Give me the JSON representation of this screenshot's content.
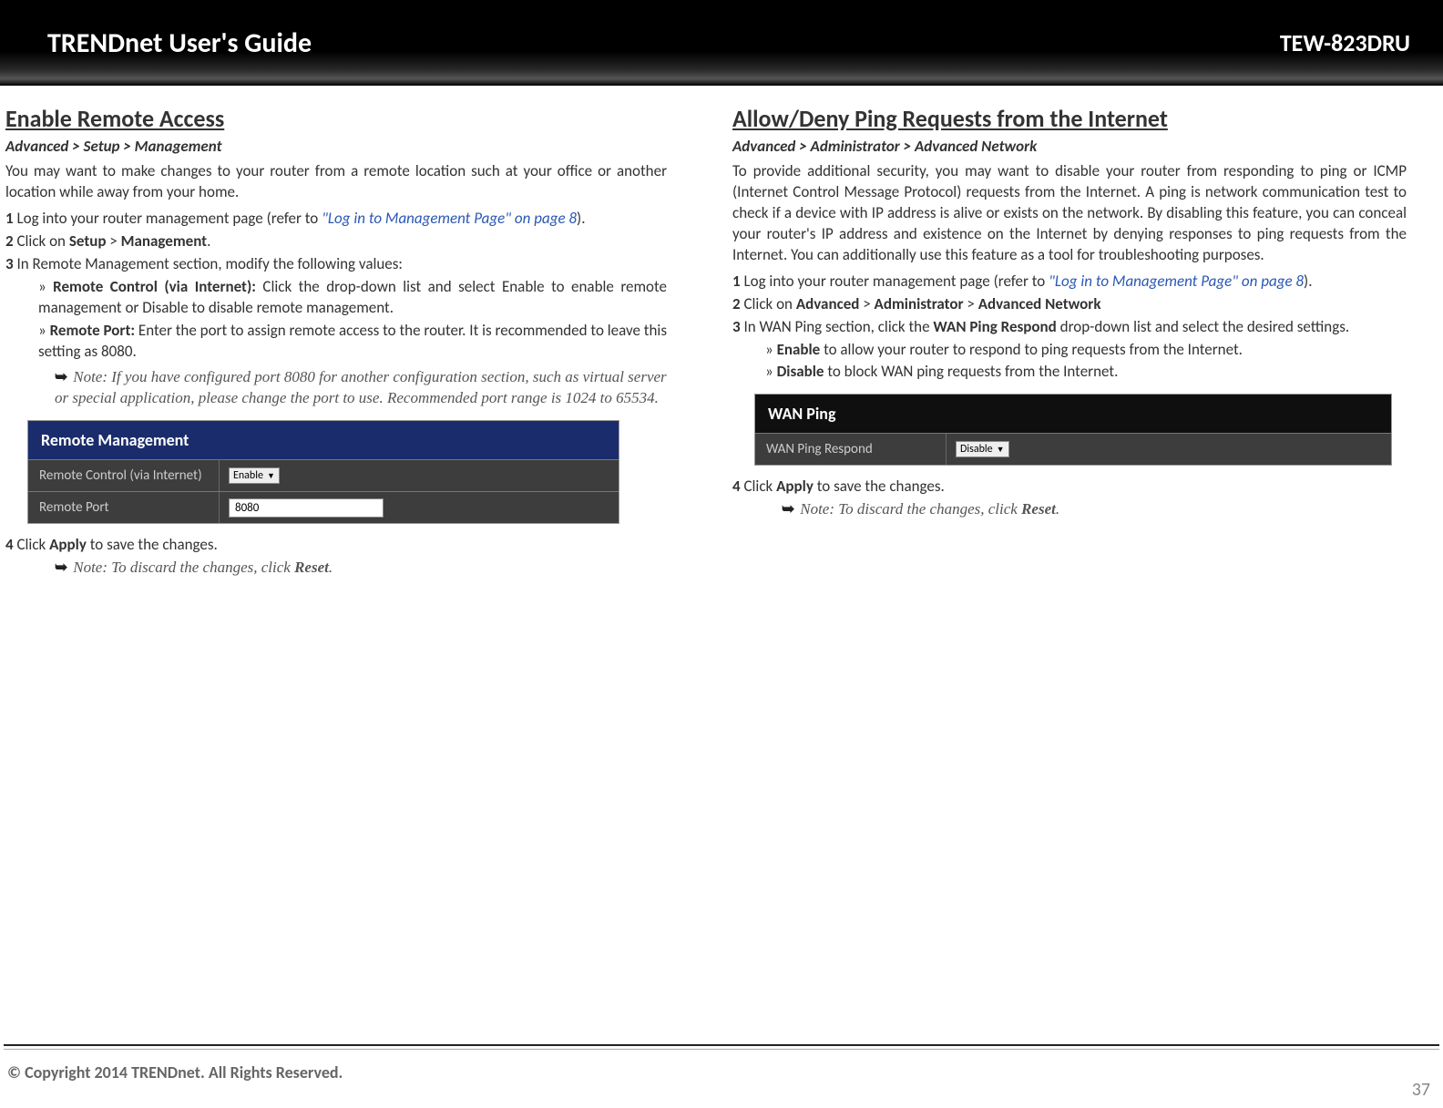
{
  "header": {
    "title": "TRENDnet User's Guide",
    "model": "TEW-823DRU"
  },
  "left": {
    "title": "Enable Remote Access",
    "path": "Advanced > Setup > Management",
    "intro": "You may want to make changes to your router from a remote location such at your office or another location while away from your home.",
    "step1_pre": "Log into your router management page (refer to ",
    "step1_link": "\"Log in to Management Page\" on page 8",
    "step1_post": ").",
    "step2": "Click on ",
    "step2_b1": "Setup",
    "step2_mid": " > ",
    "step2_b2": "Management",
    "step2_end": ".",
    "step3": "In Remote Management section, modify the following values:",
    "bullet1_b": "Remote Control (via Internet):",
    "bullet1_rest": " Click the drop-down list and select Enable to enable remote management or Disable to disable remote management.",
    "bullet2_b": "Remote Port:",
    "bullet2_rest": " Enter the port to assign remote access to the router. It is recommended to leave this setting as 8080.",
    "note1": "Note: If you have configured port 8080 for another configuration section, such as virtual server or special application, please change the port to use. Recommended port range is 1024 to 65534.",
    "table_title": "Remote Management",
    "row1_label": "Remote Control (via Internet)",
    "row1_value": "Enable",
    "row2_label": "Remote Port",
    "row2_value": "8080",
    "step4_pre": "Click ",
    "step4_b": "Apply",
    "step4_post": " to save the changes.",
    "note2_pre": "Note: To discard the changes, click ",
    "note2_b": "Reset",
    "note2_post": "."
  },
  "right": {
    "title": "Allow/Deny Ping Requests from the Internet",
    "path": "Advanced > Administrator > Advanced Network",
    "intro": "To provide additional security, you may want to disable your router from responding to ping or ICMP (Internet Control Message Protocol) requests from the Internet. A ping is network communication test to check if a device with IP address is alive or exists on the network. By disabling this feature, you can conceal your router's IP address and existence on the Internet by denying responses to ping requests from the Internet. You can additionally use this feature as a tool for troubleshooting purposes.",
    "step1_pre": "Log into your router management page (refer to ",
    "step1_link": "\"Log in to Management Page\" on page 8",
    "step1_post": ").",
    "step2_pre": "Click on ",
    "step2_b1": "Advanced",
    "step2_m1": " > ",
    "step2_b2": "Administrator",
    "step2_m2": " > ",
    "step2_b3": "Advanced Network",
    "step3_pre": "In WAN Ping section, click the ",
    "step3_b": "WAN Ping Respond",
    "step3_post": " drop-down list and select the desired settings.",
    "bullet1_b": "Enable",
    "bullet1_rest": " to allow your router to respond to ping requests from the Internet.",
    "bullet2_b": "Disable",
    "bullet2_rest": " to block WAN ping requests from the Internet.",
    "table_title": "WAN Ping",
    "row1_label": "WAN Ping Respond",
    "row1_value": "Disable",
    "step4_pre": "Click ",
    "step4_b": "Apply",
    "step4_post": " to save the changes.",
    "note2_pre": "Note: To discard the changes, click ",
    "note2_b": "Reset",
    "note2_post": "."
  },
  "footer": {
    "copyright": "© Copyright 2014 TRENDnet. All Rights Reserved.",
    "page": "37"
  }
}
